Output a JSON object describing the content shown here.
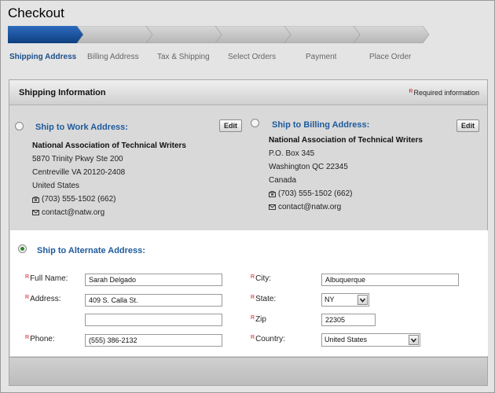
{
  "title": "Checkout",
  "steps": [
    {
      "label": "Shipping Address",
      "active": true
    },
    {
      "label": "Billing Address",
      "active": false
    },
    {
      "label": "Tax & Shipping",
      "active": false
    },
    {
      "label": "Select Orders",
      "active": false
    },
    {
      "label": "Payment",
      "active": false
    },
    {
      "label": "Place Order",
      "active": false
    }
  ],
  "panel": {
    "title": "Shipping Information",
    "required_mark": "R",
    "required_text": "Required information"
  },
  "work_address": {
    "heading": "Ship to Work Address:",
    "edit_label": "Edit",
    "org": "National Association of Technical Writers",
    "line1": "5870 Trinity Pkwy Ste 200",
    "line2": "Centreville VA 20120-2408",
    "line3": "United States",
    "phone": "(703) 555-1502 (662)",
    "email": "contact@natw.org",
    "selected": false
  },
  "billing_address": {
    "heading": "Ship to Billing Address:",
    "edit_label": "Edit",
    "org": "National Association of Technical Writers",
    "line1": "P.O. Box 345",
    "line2": "Washington QC 22345",
    "line3": "Canada",
    "phone": "(703) 555-1502 (662)",
    "email": "contact@natw.org",
    "selected": false
  },
  "alternate": {
    "heading": "Ship to Alternate Address:",
    "selected": true,
    "full_name_label": "Full Name:",
    "full_name": "Sarah Delgado",
    "address_label": "Address:",
    "address1": "409 S. Calla St.",
    "address2": "",
    "phone_label": "Phone:",
    "phone": "(555) 386-2132",
    "city_label": "City:",
    "city": "Albuquerque",
    "state_label": "State:",
    "state": "NY",
    "zip_label": "Zip",
    "zip": "22305",
    "country_label": "Country:",
    "country": "United States"
  },
  "colors": {
    "accent": "#1d5a9c",
    "active_step": "#1a4f95",
    "required": "#c8141b"
  }
}
